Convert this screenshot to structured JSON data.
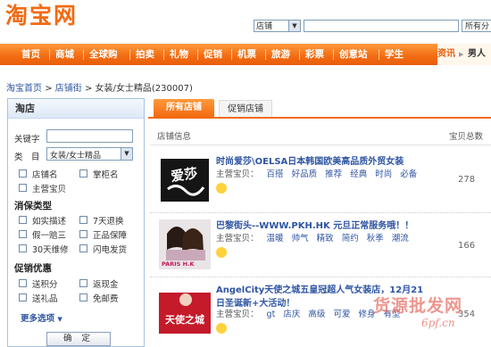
{
  "header": {
    "logo_text": "淘宝网",
    "search_scope": "店铺",
    "search_value": "",
    "search_scope_right": "所有分"
  },
  "nav": {
    "items": [
      "首页",
      "商城",
      "全球购",
      "拍卖",
      "礼物",
      "促销",
      "机票",
      "旅游",
      "彩票",
      "创意站",
      "学生"
    ],
    "right_items": [
      "资讯",
      "男人"
    ]
  },
  "breadcrumb": {
    "home": "淘宝首页",
    "sep1": ">",
    "street": "店铺街",
    "sep2": ">",
    "current": "女装/女士精品(230007)"
  },
  "left": {
    "title": "淘店",
    "keyword_label": "关键字",
    "keyword_value": "",
    "category_label": "类　目",
    "category_value": "女装/女士精品",
    "opt_shop_name": "店铺名",
    "opt_seller_name": "掌柜名",
    "opt_main_item": "主营宝贝",
    "consumer_title": "消保类型",
    "consumer": [
      "如实描述",
      "7天退换",
      "假一赔三",
      "正品保障",
      "30天维修",
      "闪电发货"
    ],
    "promo_title": "促销优惠",
    "promo": [
      "送积分",
      "返现金",
      "送礼品",
      "免邮费"
    ],
    "more_options": "更多选项",
    "confirm": "确 定"
  },
  "tabs": {
    "all": "所有店铺",
    "promo": "促销店铺"
  },
  "list": {
    "header_info": "店铺信息",
    "header_count": "宝贝总数",
    "main_label": "主营宝贝：",
    "shops": [
      {
        "name": "时尚爱莎\\OELSA日本韩国欧美高品质外贸女装",
        "keywords": [
          "百搭",
          "好品质",
          "推荐",
          "经典",
          "时尚",
          "必备"
        ],
        "count": "278",
        "img_text": "爱莎"
      },
      {
        "name": "巴黎街头--WWW.PKH.HK 元旦正常服务哦！！",
        "keywords": [
          "温暖",
          "帅气",
          "精致",
          "简约",
          "秋季",
          "潮流"
        ],
        "count": "166",
        "img_text": "PARIS H.K"
      },
      {
        "name": "AngelCity天使之城五皇冠超人气女装店，12月21日圣诞新+大活动！",
        "name_line1": "AngelCity天使之城五皇冠超人气女装店，12月21",
        "name_line2": "日圣诞新+大活动！",
        "keywords": [
          "gt",
          "店庆",
          "高级",
          "可爱",
          "修身",
          "有型"
        ],
        "count": "354",
        "img_text": "天使之城"
      }
    ]
  },
  "watermark": {
    "text": "货源批发网",
    "url": "6pf.cn"
  }
}
